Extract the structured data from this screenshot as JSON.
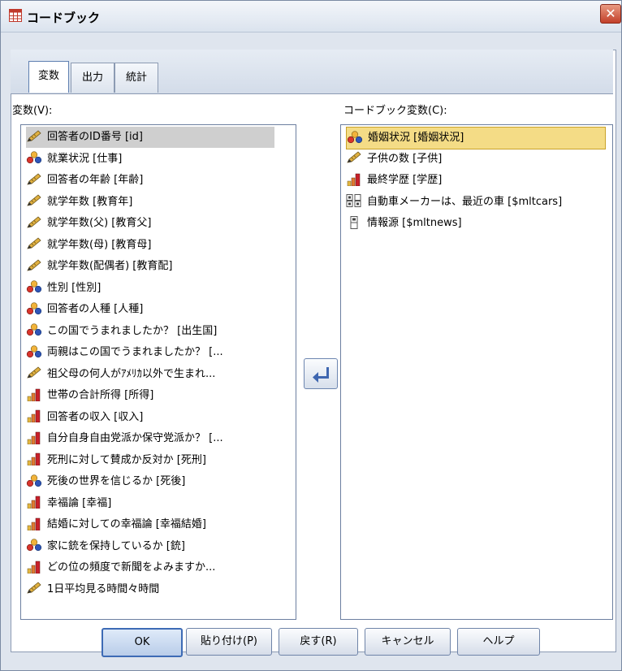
{
  "window": {
    "title": "コードブック",
    "close_label": "✕"
  },
  "tabs": [
    {
      "label": "変数",
      "active": true
    },
    {
      "label": "出力",
      "active": false
    },
    {
      "label": "統計",
      "active": false
    }
  ],
  "variables_list": {
    "label": "変数(V):",
    "items": [
      {
        "text": "回答者のID番号 [id]",
        "type": "scale"
      },
      {
        "text": "就業状況 [仕事]",
        "type": "nominal"
      },
      {
        "text": "回答者の年齢 [年齢]",
        "type": "scale"
      },
      {
        "text": "就学年数 [教育年]",
        "type": "scale"
      },
      {
        "text": "就学年数(父) [教育父]",
        "type": "scale"
      },
      {
        "text": "就学年数(母) [教育母]",
        "type": "scale"
      },
      {
        "text": "就学年数(配偶者) [教育配]",
        "type": "scale"
      },
      {
        "text": "性別 [性別]",
        "type": "nominal"
      },
      {
        "text": "回答者の人種 [人種]",
        "type": "nominal"
      },
      {
        "text": "この国でうまれましたか？ [出生国]",
        "type": "nominal"
      },
      {
        "text": "両親はこの国でうまれましたか？ [...",
        "type": "nominal"
      },
      {
        "text": "祖父母の何人がｱﾒﾘｶ以外で生まれ...",
        "type": "scale"
      },
      {
        "text": "世帯の合計所得 [所得]",
        "type": "ordinal"
      },
      {
        "text": "回答者の収入 [収入]",
        "type": "ordinal"
      },
      {
        "text": "自分自身自由党派か保守党派か？ [...",
        "type": "ordinal"
      },
      {
        "text": "死刑に対して賛成か反対か [死刑]",
        "type": "ordinal"
      },
      {
        "text": "死後の世界を信じるか [死後]",
        "type": "nominal"
      },
      {
        "text": "幸福論 [幸福]",
        "type": "ordinal"
      },
      {
        "text": "結婚に対しての幸福論 [幸福結婚]",
        "type": "ordinal"
      },
      {
        "text": "家に銃を保持しているか [銃]",
        "type": "nominal"
      },
      {
        "text": "どの位の頻度で新聞をよみますか...",
        "type": "ordinal"
      },
      {
        "text": "1日平均見る時間々時間",
        "type": "scale"
      }
    ],
    "selected_index": 0
  },
  "codebook_list": {
    "label": "コードブック変数(C):",
    "items": [
      {
        "text": "婚姻状況 [婚姻状況]",
        "type": "nominal"
      },
      {
        "text": "子供の数 [子供]",
        "type": "scale"
      },
      {
        "text": "最終学歴 [学歴]",
        "type": "ordinal"
      },
      {
        "text": "自動車メーカーは、最近の車 [$mltcars]",
        "type": "multi-dichotomy"
      },
      {
        "text": "情報源 [$mltnews]",
        "type": "multi-category"
      }
    ],
    "selected_index": 0
  },
  "buttons": {
    "ok": "OK",
    "paste": "貼り付け(P)",
    "reset": "戻す(R)",
    "cancel": "キャンセル",
    "help": "ヘルプ"
  },
  "colors": {
    "nominal_a": "#2f55b8",
    "nominal_b": "#d9342b",
    "nominal_c": "#f2b33a",
    "ordinal_bar": "#c8202a",
    "scale_pencil": "#e0b040",
    "selection_target": "#f4dc86",
    "selection_source": "#cfcfcf"
  }
}
